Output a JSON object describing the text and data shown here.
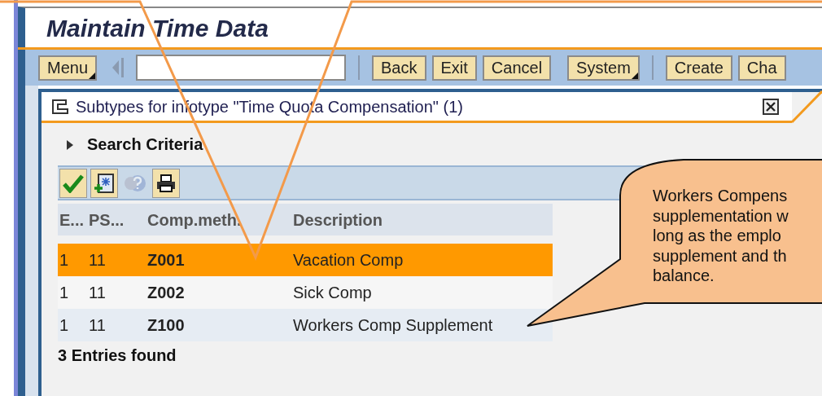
{
  "window": {
    "title": "Maintain Time Data"
  },
  "toolbar": {
    "items": [
      {
        "kind": "button",
        "label": "Menu",
        "dropdown": true
      },
      {
        "kind": "back-arrow"
      },
      {
        "kind": "field"
      },
      {
        "kind": "separator"
      },
      {
        "kind": "button",
        "label": "Back",
        "dropdown": false
      },
      {
        "kind": "button",
        "label": "Exit",
        "dropdown": false
      },
      {
        "kind": "button",
        "label": "Cancel",
        "dropdown": false
      },
      {
        "kind": "gap"
      },
      {
        "kind": "button",
        "label": "System",
        "dropdown": true
      },
      {
        "kind": "separator"
      },
      {
        "kind": "button",
        "label": "Create",
        "dropdown": false
      },
      {
        "kind": "button",
        "label": "Cha",
        "dropdown": false
      }
    ]
  },
  "dialog": {
    "title": "Subtypes for infotype \"Time Quota Compensation\" (1)",
    "search_criteria": {
      "label": "Search Criteria",
      "expanded": false
    },
    "tools": [
      {
        "kind": "check",
        "disabled": false
      },
      {
        "kind": "new",
        "disabled": false
      },
      {
        "kind": "help",
        "disabled": true
      },
      {
        "kind": "print",
        "disabled": false
      }
    ],
    "table": {
      "columns": [
        "E...",
        "PS...",
        "Comp.meth.",
        "Description"
      ],
      "rows": [
        {
          "cells": [
            "1",
            "11",
            "Z001",
            "Vacation Comp"
          ],
          "selected": true
        },
        {
          "cells": [
            "1",
            "11",
            "Z002",
            "Sick Comp"
          ],
          "selected": false
        },
        {
          "cells": [
            "1",
            "11",
            "Z100",
            "Workers Comp Supplement"
          ],
          "selected": false
        }
      ]
    },
    "status": "3 Entries found"
  },
  "callout": {
    "lines": [
      "Workers Compens",
      "supplementation w",
      "long as the emplo",
      "supplement and th",
      "balance."
    ]
  }
}
